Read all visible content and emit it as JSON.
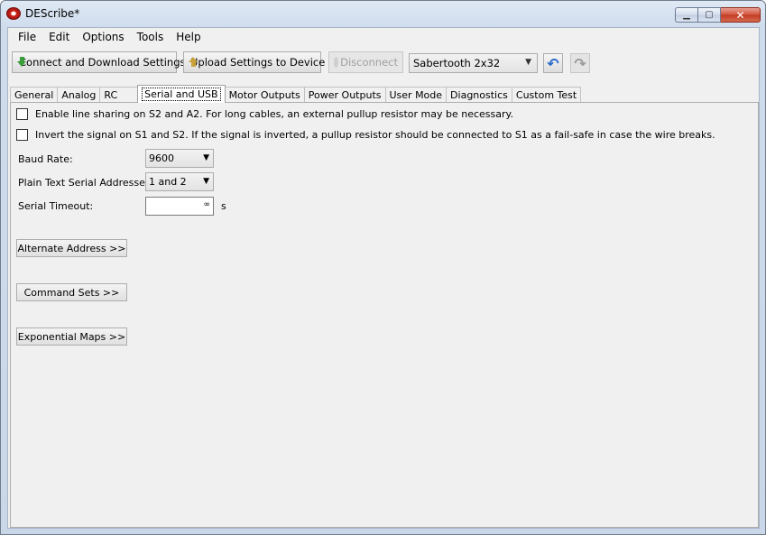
{
  "window": {
    "title": "DEScribe*"
  },
  "menu": [
    {
      "label": "File"
    },
    {
      "label": "Edit"
    },
    {
      "label": "Options"
    },
    {
      "label": "Tools"
    },
    {
      "label": "Help"
    }
  ],
  "toolbar": {
    "connect_label": "Connect and Download Settings",
    "upload_label": "Upload Settings to Device",
    "disconnect_label": "Disconnect",
    "device_selected": "Sabertooth 2x32"
  },
  "tabs": [
    "General",
    "Analog",
    "RC",
    "Serial and USB",
    "Motor Outputs",
    "Power Outputs",
    "User Mode",
    "Diagnostics",
    "Custom Test"
  ],
  "active_tab": "Serial and USB",
  "serial": {
    "line_sharing_label": "Enable line sharing on S2 and A2. For long cables, an external pullup resistor may be necessary.",
    "line_sharing_checked": false,
    "invert_label": "Invert the signal on S1 and S2. If the signal is inverted, a pullup resistor should be connected to S1 as a fail-safe in case the wire breaks.",
    "invert_checked": false,
    "baud_label": "Baud Rate:",
    "baud_value": "9600",
    "addresses_label": "Plain Text Serial Addresses:",
    "addresses_value": "1 and 2",
    "timeout_label": "Serial Timeout:",
    "timeout_value": "∞",
    "timeout_unit": "s",
    "alternate_address_label": "Alternate Address >>",
    "command_sets_label": "Command Sets >>",
    "exponential_maps_label": "Exponential Maps >>"
  }
}
